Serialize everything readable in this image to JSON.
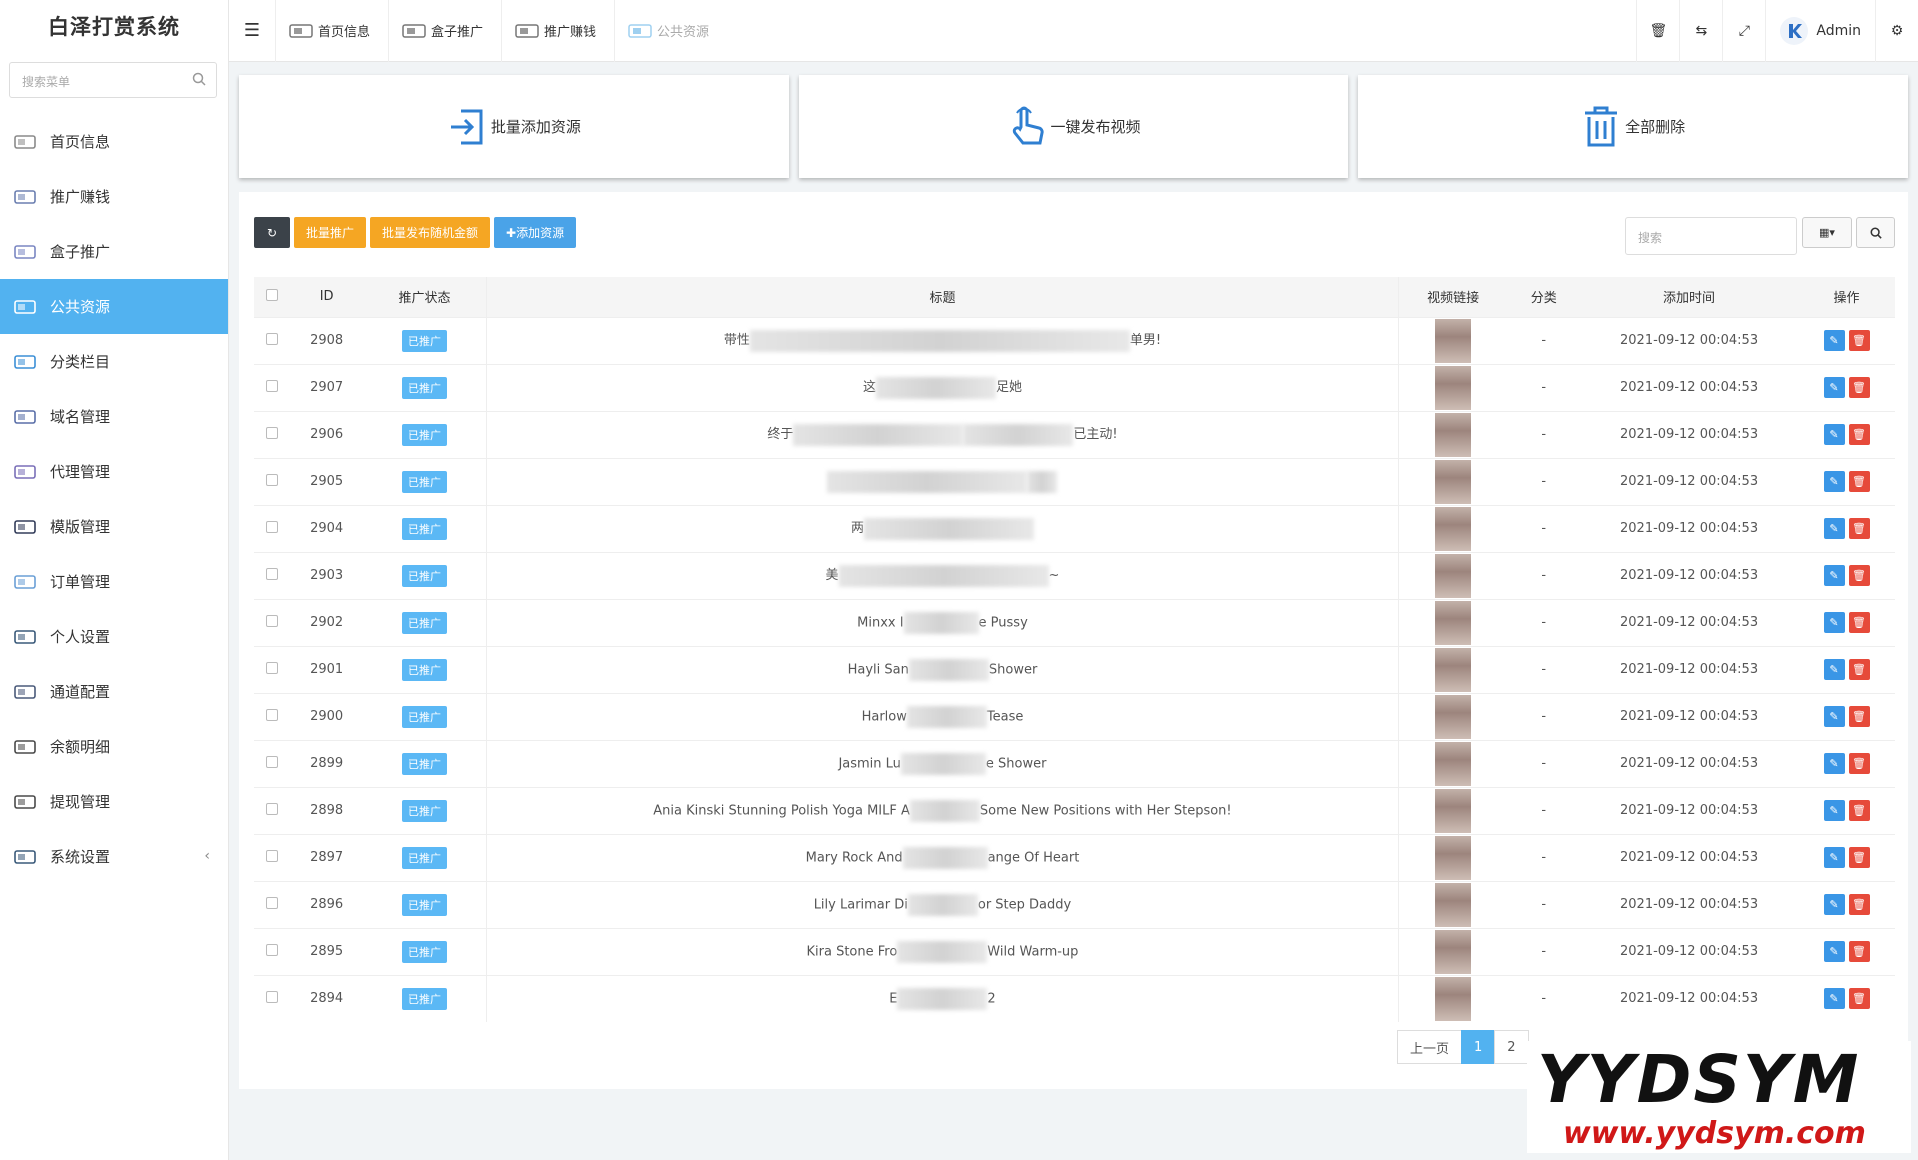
{
  "app": {
    "title": "白泽打赏系统"
  },
  "sidebar": {
    "search_placeholder": "搜索菜单",
    "items": [
      {
        "label": "首页信息",
        "icon": "home-icon"
      },
      {
        "label": "推广赚钱",
        "icon": "promote-icon"
      },
      {
        "label": "盒子推广",
        "icon": "box-icon"
      },
      {
        "label": "公共资源",
        "icon": "resource-icon",
        "active": true
      },
      {
        "label": "分类栏目",
        "icon": "category-icon"
      },
      {
        "label": "域名管理",
        "icon": "domain-icon"
      },
      {
        "label": "代理管理",
        "icon": "agent-icon"
      },
      {
        "label": "模版管理",
        "icon": "template-icon"
      },
      {
        "label": "订单管理",
        "icon": "order-icon"
      },
      {
        "label": "个人设置",
        "icon": "profile-icon"
      },
      {
        "label": "通道配置",
        "icon": "channel-icon"
      },
      {
        "label": "余额明细",
        "icon": "balance-icon"
      },
      {
        "label": "提现管理",
        "icon": "withdraw-icon"
      },
      {
        "label": "系统设置",
        "icon": "settings-icon",
        "arrow": "‹"
      }
    ]
  },
  "header": {
    "tabs": [
      {
        "label": "首页信息"
      },
      {
        "label": "盒子推广"
      },
      {
        "label": "推广赚钱"
      },
      {
        "label": "公共资源"
      }
    ],
    "user": "Admin"
  },
  "cards": [
    {
      "label": "批量添加资源",
      "icon": "import-icon"
    },
    {
      "label": "一键发布视频",
      "icon": "hand-pointer-icon"
    },
    {
      "label": "全部删除",
      "icon": "trash-icon"
    }
  ],
  "toolbar": {
    "batch_promote": "批量推广",
    "batch_random": "批量发布随机金额",
    "add_resource": "✚添加资源",
    "search_placeholder": "搜索"
  },
  "table": {
    "headers": [
      "ID",
      "推广状态",
      "标题",
      "视频链接",
      "分类",
      "添加时间",
      "操作"
    ],
    "rows": [
      {
        "id": "2908",
        "status": "已推广",
        "title_pre": "带性",
        "title_post": "单男!",
        "cat": "-",
        "time": "2021-09-12 00:04:53"
      },
      {
        "id": "2907",
        "status": "已推广",
        "title_pre": "这",
        "title_post": "足她",
        "cat": "-",
        "time": "2021-09-12 00:04:53"
      },
      {
        "id": "2906",
        "status": "已推广",
        "title_pre": "终于",
        "title_post": "已主动!",
        "cat": "-",
        "time": "2021-09-12 00:04:53"
      },
      {
        "id": "2905",
        "status": "已推广",
        "title_pre": "",
        "title_post": "",
        "cat": "-",
        "time": "2021-09-12 00:04:53"
      },
      {
        "id": "2904",
        "status": "已推广",
        "title_pre": "两",
        "title_post": "",
        "cat": "-",
        "time": "2021-09-12 00:04:53"
      },
      {
        "id": "2903",
        "status": "已推广",
        "title_pre": "美",
        "title_post": "~",
        "cat": "-",
        "time": "2021-09-12 00:04:53"
      },
      {
        "id": "2902",
        "status": "已推广",
        "title_pre": "Minxx I",
        "title_post": "e Pussy",
        "cat": "-",
        "time": "2021-09-12 00:04:53"
      },
      {
        "id": "2901",
        "status": "已推广",
        "title_pre": "Hayli San",
        "title_post": "Shower",
        "cat": "-",
        "time": "2021-09-12 00:04:53"
      },
      {
        "id": "2900",
        "status": "已推广",
        "title_pre": "Harlow",
        "title_post": "Tease",
        "cat": "-",
        "time": "2021-09-12 00:04:53"
      },
      {
        "id": "2899",
        "status": "已推广",
        "title_pre": "Jasmin Lu",
        "title_post": "e Shower",
        "cat": "-",
        "time": "2021-09-12 00:04:53"
      },
      {
        "id": "2898",
        "status": "已推广",
        "title_pre": "Ania Kinski Stunning Polish Yoga MILF A",
        "title_post": "Some New Positions with Her Stepson!",
        "cat": "-",
        "time": "2021-09-12 00:04:53"
      },
      {
        "id": "2897",
        "status": "已推广",
        "title_pre": "Mary Rock And",
        "title_post": "ange Of Heart",
        "cat": "-",
        "time": "2021-09-12 00:04:53"
      },
      {
        "id": "2896",
        "status": "已推广",
        "title_pre": "Lily Larimar Di",
        "title_post": "or Step Daddy",
        "cat": "-",
        "time": "2021-09-12 00:04:53"
      },
      {
        "id": "2895",
        "status": "已推广",
        "title_pre": "Kira Stone Fro",
        "title_post": "Wild Warm-up",
        "cat": "-",
        "time": "2021-09-12 00:04:53"
      },
      {
        "id": "2894",
        "status": "已推广",
        "title_pre": "E",
        "title_post": "2",
        "cat": "-",
        "time": "2021-09-12 00:04:53"
      }
    ]
  },
  "pagination": {
    "prev": "上一页",
    "pages": [
      "1",
      "2"
    ],
    "current": "1"
  },
  "watermark": {
    "line1": "YYDSYM",
    "line2": "www.yydsym.com"
  }
}
